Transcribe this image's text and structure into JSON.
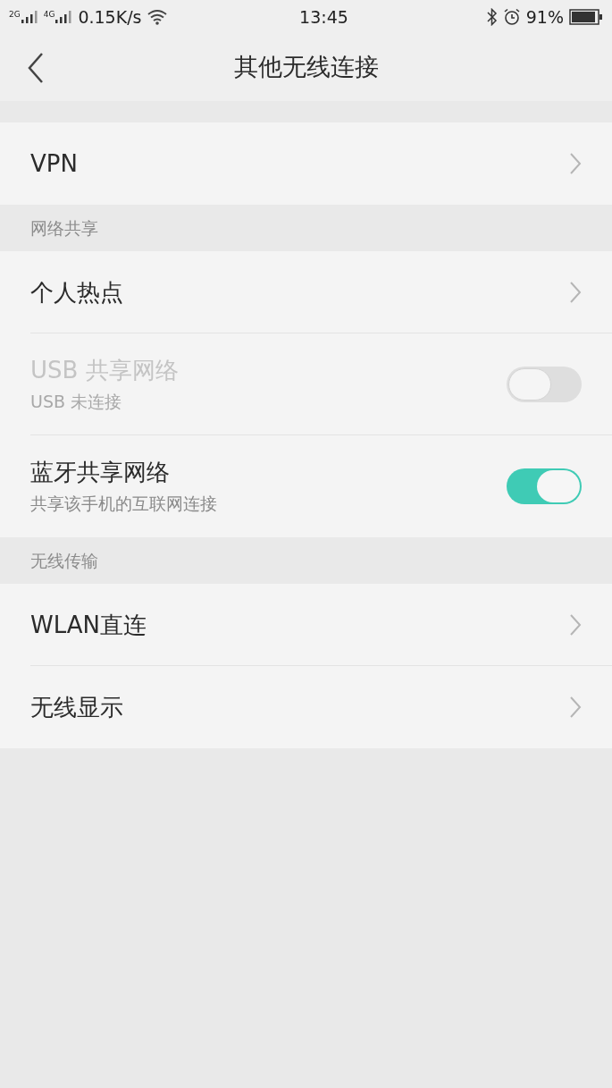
{
  "status_bar": {
    "sim_1": "2G",
    "sim_2": "4G",
    "speed": "0.15K/s",
    "time": "13:45",
    "battery": "91%"
  },
  "header": {
    "title": "其他无线连接"
  },
  "sections": [
    {
      "items": [
        {
          "kind": "link",
          "title": "VPN",
          "disabled": false
        }
      ]
    },
    {
      "heading": "网络共享",
      "items": [
        {
          "kind": "link",
          "title": "个人热点",
          "disabled": false
        },
        {
          "kind": "toggle",
          "title": "USB 共享网络",
          "subtitle": "USB 未连接",
          "on": false,
          "disabled": true
        },
        {
          "kind": "toggle",
          "title": "蓝牙共享网络",
          "subtitle": "共享该手机的互联网连接",
          "on": true,
          "disabled": false
        }
      ]
    },
    {
      "heading": "无线传输",
      "items": [
        {
          "kind": "link",
          "title": "WLAN直连",
          "disabled": false
        },
        {
          "kind": "link",
          "title": "无线显示",
          "disabled": false
        }
      ]
    }
  ]
}
